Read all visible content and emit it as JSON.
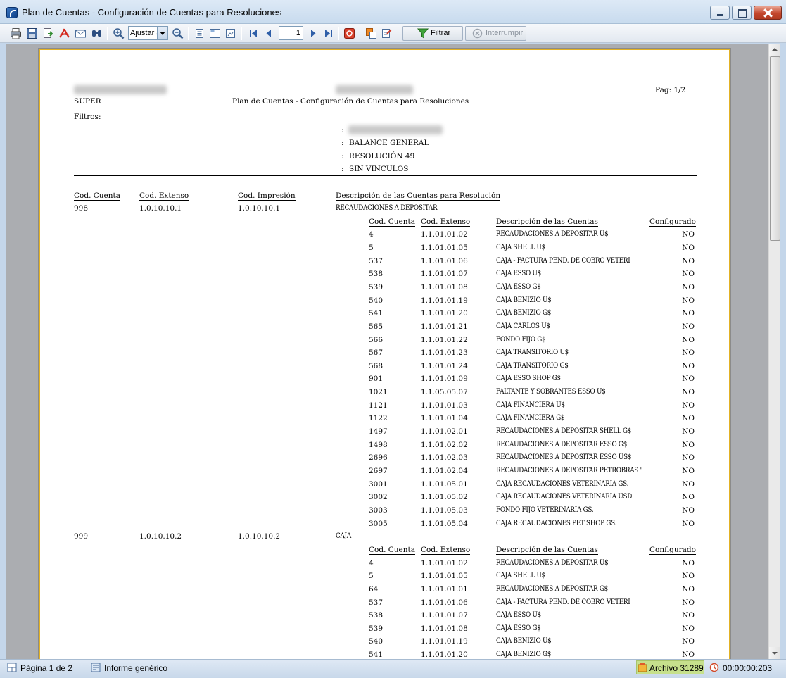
{
  "window": {
    "title": "Plan de Cuentas - Configuración de Cuentas para Resoluciones",
    "accent_color": "#c4d6ea",
    "close_color": "#c4472c"
  },
  "toolbar": {
    "zoom_value": "Ajustar a",
    "page_input_value": "1",
    "filtrar_label": "Filtrar",
    "interrumpir_label": "Interrumpir",
    "icons": [
      "printer-icon",
      "save-icon",
      "export-icon",
      "pdf-icon",
      "email-icon",
      "find-icon",
      "zoom-in-icon",
      "zoom-out-icon",
      "single-page-icon",
      "two-page-icon",
      "thumbnails-icon",
      "first-page-icon",
      "prev-page-icon",
      "next-page-icon",
      "last-page-icon",
      "stop-icon",
      "copy-icon",
      "settings-icon",
      "filter-icon",
      "interrupt-icon"
    ]
  },
  "report": {
    "company_redacted": "",
    "header_redacted": "",
    "user": "SUPER",
    "title": "Plan de Cuentas - Configuración de Cuentas para Resoluciones",
    "page_label": "Pag: 1/2",
    "filters_label": "Filtros:",
    "filters": [
      {
        "prefix": ":",
        "value": ""
      },
      {
        "prefix": ":",
        "value": "BALANCE GENERAL"
      },
      {
        "prefix": ":",
        "value": "RESOLUCIÓN 49"
      },
      {
        "prefix": ":",
        "value": "SIN VINCULOS"
      }
    ],
    "main_headers": {
      "cod_cuenta": "Cod. Cuenta",
      "cod_extenso": "Cod. Extenso",
      "cod_impresion": "Cod. Impresión",
      "descripcion": "Descripción de las Cuentas para Resolución"
    },
    "sub_headers": {
      "cod_cuenta": "Cod. Cuenta",
      "cod_extenso": "Cod. Extenso",
      "descripcion": "Descripción de las Cuentas",
      "configurado": "Configurado"
    },
    "groups": [
      {
        "cod_cuenta": "998",
        "cod_extenso": "1.0.10.10.1",
        "cod_impresion": "1.0.10.10.1",
        "descripcion": "RECAUDACIONES A DEPOSITAR",
        "rows": [
          {
            "cod": "4",
            "ext": "1.1.01.01.02",
            "desc": "RECAUDACIONES A DEPOSITAR U$",
            "conf": "NO"
          },
          {
            "cod": "5",
            "ext": "1.1.01.01.05",
            "desc": "CAJA SHELL U$",
            "conf": "NO"
          },
          {
            "cod": "537",
            "ext": "1.1.01.01.06",
            "desc": "CAJA - FACTURA PEND. DE COBRO VETERI",
            "conf": "NO"
          },
          {
            "cod": "538",
            "ext": "1.1.01.01.07",
            "desc": "CAJA ESSO U$",
            "conf": "NO"
          },
          {
            "cod": "539",
            "ext": "1.1.01.01.08",
            "desc": "CAJA ESSO G$",
            "conf": "NO"
          },
          {
            "cod": "540",
            "ext": "1.1.01.01.19",
            "desc": "CAJA BENIZIO U$",
            "conf": "NO"
          },
          {
            "cod": "541",
            "ext": "1.1.01.01.20",
            "desc": "CAJA BENIZIO G$",
            "conf": "NO"
          },
          {
            "cod": "565",
            "ext": "1.1.01.01.21",
            "desc": "CAJA CARLOS  U$",
            "conf": "NO"
          },
          {
            "cod": "566",
            "ext": "1.1.01.01.22",
            "desc": "FONDO FIJO  G$",
            "conf": "NO"
          },
          {
            "cod": "567",
            "ext": "1.1.01.01.23",
            "desc": "CAJA TRANSITORIO U$",
            "conf": "NO"
          },
          {
            "cod": "568",
            "ext": "1.1.01.01.24",
            "desc": "CAJA TRANSITORIO G$",
            "conf": "NO"
          },
          {
            "cod": "901",
            "ext": "1.1.01.01.09",
            "desc": "CAJA ESSO SHOP G$",
            "conf": "NO"
          },
          {
            "cod": "1021",
            "ext": "1.1.05.05.07",
            "desc": "FALTANTE Y SOBRANTES ESSO U$",
            "conf": "NO"
          },
          {
            "cod": "1121",
            "ext": "1.1.01.01.03",
            "desc": "CAJA FINANCIERA  U$",
            "conf": "NO"
          },
          {
            "cod": "1122",
            "ext": "1.1.01.01.04",
            "desc": "CAJA FINANCIERA G$",
            "conf": "NO"
          },
          {
            "cod": "1497",
            "ext": "1.1.01.02.01",
            "desc": "RECAUDACIONES A DEPOSITAR SHELL G$",
            "conf": "NO"
          },
          {
            "cod": "1498",
            "ext": "1.1.01.02.02",
            "desc": "RECAUDACIONES A DEPOSITAR  ESSO G$",
            "conf": "NO"
          },
          {
            "cod": "2696",
            "ext": "1.1.01.02.03",
            "desc": "RECAUDACIONES A DEPOSITAR ESSO US$",
            "conf": "NO"
          },
          {
            "cod": "2697",
            "ext": "1.1.01.02.04",
            "desc": "RECAUDACIONES A DEPOSITAR PETROBRAS '",
            "conf": "NO"
          },
          {
            "cod": "3001",
            "ext": "1.1.01.05.01",
            "desc": "CAJA RECAUDACIONES VETERINARIA GS.",
            "conf": "NO"
          },
          {
            "cod": "3002",
            "ext": "1.1.01.05.02",
            "desc": "CAJA RECAUDACIONES VETERINARIA USD",
            "conf": "NO"
          },
          {
            "cod": "3003",
            "ext": "1.1.01.05.03",
            "desc": "FONDO FIJO VETERINARIA GS.",
            "conf": "NO"
          },
          {
            "cod": "3005",
            "ext": "1.1.01.05.04",
            "desc": "CAJA RECAUDACIONES PET SHOP GS.",
            "conf": "NO"
          }
        ]
      },
      {
        "cod_cuenta": "999",
        "cod_extenso": "1.0.10.10.2",
        "cod_impresion": "1.0.10.10.2",
        "descripcion": "CAJA",
        "rows": [
          {
            "cod": "4",
            "ext": "1.1.01.01.02",
            "desc": "RECAUDACIONES A DEPOSITAR U$",
            "conf": "NO"
          },
          {
            "cod": "5",
            "ext": "1.1.01.01.05",
            "desc": "CAJA SHELL U$",
            "conf": "NO"
          },
          {
            "cod": "64",
            "ext": "1.1.01.01.01",
            "desc": "RECAUDACIONES A DEPOSITAR  G$",
            "conf": "NO"
          },
          {
            "cod": "537",
            "ext": "1.1.01.01.06",
            "desc": "CAJA - FACTURA PEND. DE COBRO VETERI",
            "conf": "NO"
          },
          {
            "cod": "538",
            "ext": "1.1.01.01.07",
            "desc": "CAJA ESSO U$",
            "conf": "NO"
          },
          {
            "cod": "539",
            "ext": "1.1.01.01.08",
            "desc": "CAJA ESSO G$",
            "conf": "NO"
          },
          {
            "cod": "540",
            "ext": "1.1.01.01.19",
            "desc": "CAJA BENIZIO U$",
            "conf": "NO"
          },
          {
            "cod": "541",
            "ext": "1.1.01.01.20",
            "desc": "CAJA BENIZIO G$",
            "conf": "NO"
          }
        ]
      }
    ]
  },
  "statusbar": {
    "page_info": "Página 1 de 2",
    "report_type": "Informe genérico",
    "archivo": "Archivo 31289",
    "timer": "00:00:00:203",
    "archivo_color": "#c6e08c"
  }
}
